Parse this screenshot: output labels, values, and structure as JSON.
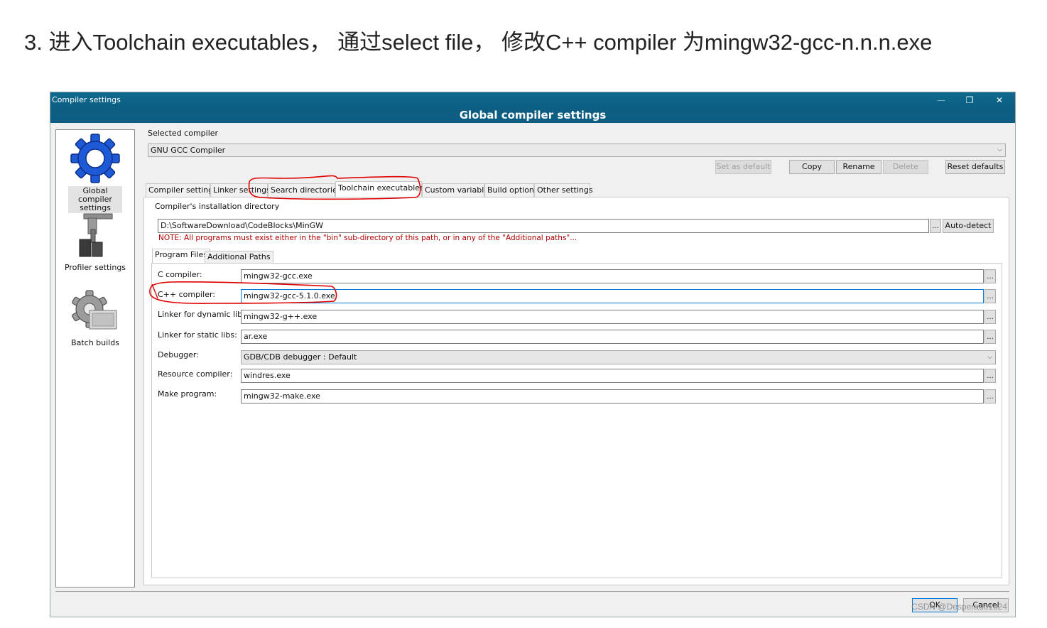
{
  "heading": "3. 进入Toolchain executables， 通过select file， 修改C++ compiler 为mingw32-gcc-n.n.n.exe",
  "window": {
    "title": "Compiler settings",
    "banner": "Global compiler settings",
    "controls": {
      "minimize": "—",
      "maximize": "❐",
      "close": "✕"
    }
  },
  "sidebar": {
    "items": [
      {
        "label": "Global compiler settings",
        "icon": "gear-icon",
        "selected": true
      },
      {
        "label": "Profiler settings",
        "icon": "profiler-icon",
        "selected": false
      },
      {
        "label": "Batch builds",
        "icon": "batch-builds-icon",
        "selected": false
      }
    ]
  },
  "compiler_select": {
    "group_label": "Selected compiler",
    "value": "GNU GCC Compiler"
  },
  "buttons": {
    "set_default": "Set as default",
    "copy": "Copy",
    "rename": "Rename",
    "delete": "Delete",
    "reset_defaults": "Reset defaults",
    "auto_detect": "Auto-detect",
    "ok": "OK",
    "cancel": "Cancel",
    "browse": "..."
  },
  "tabs": [
    "Compiler settings",
    "Linker settings",
    "Search directories",
    "Toolchain executables",
    "Custom variables",
    "Build options",
    "Other settings"
  ],
  "active_tab": "Toolchain executables",
  "install_dir": {
    "group_label": "Compiler's installation directory",
    "value": "D:\\SoftwareDownload\\CodeBlocks\\MinGW",
    "note": "NOTE: All programs must exist either in the \"bin\" sub-directory of this path, or in any of the \"Additional paths\"..."
  },
  "subtabs": [
    "Program Files",
    "Additional Paths"
  ],
  "program_files": {
    "c_compiler_label": "C compiler:",
    "c_compiler": "mingw32-gcc.exe",
    "cpp_compiler_label": "C++ compiler:",
    "cpp_compiler": "mingw32-gcc-5.1.0.exe",
    "linker_dynamic_label": "Linker for dynamic libs:",
    "linker_dynamic": "mingw32-g++.exe",
    "linker_static_label": "Linker for static libs:",
    "linker_static": "ar.exe",
    "debugger_label": "Debugger:",
    "debugger": "GDB/CDB debugger : Default",
    "resource_compiler_label": "Resource compiler:",
    "resource_compiler": "windres.exe",
    "make_program_label": "Make program:",
    "make_program": "mingw32-make.exe"
  },
  "watermark": "CSDN @Desperado1024",
  "colors": {
    "titlebar": "#0f6a8e",
    "banner": "#0d5e82",
    "annotation": "#e00000",
    "note": "#b00000",
    "focus": "#0078d7"
  }
}
